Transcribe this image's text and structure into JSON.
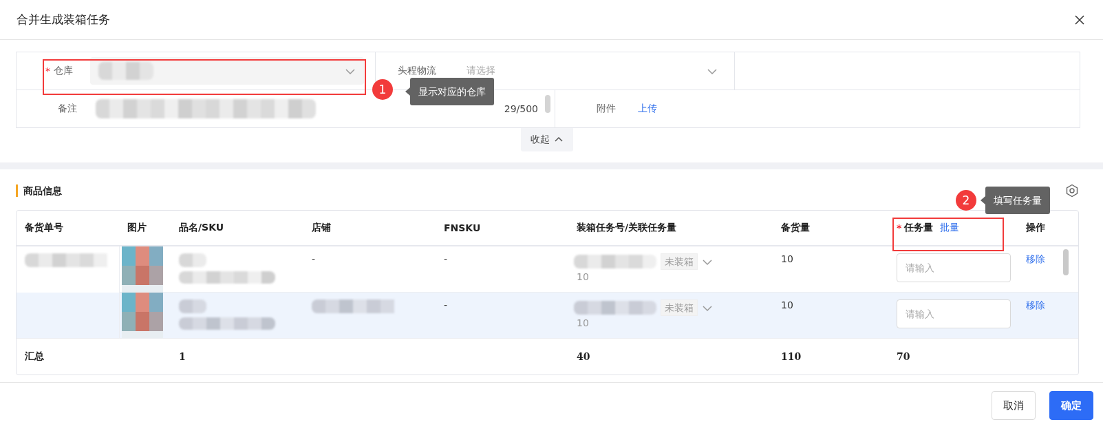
{
  "dialog": {
    "title": "合并生成装箱任务"
  },
  "form": {
    "warehouse": {
      "label": "仓库",
      "required_mark": "*",
      "value": {
        "kind": "redacted"
      }
    },
    "first_leg": {
      "label": "头程物流",
      "placeholder": "请选择"
    },
    "remark": {
      "label": "备注",
      "value": {
        "kind": "redacted"
      },
      "count": "29/500"
    },
    "attachment": {
      "label": "附件",
      "link": "上传"
    },
    "collapse": "收起"
  },
  "section": {
    "title": "商品信息"
  },
  "table": {
    "columns": [
      {
        "label": "备货单号"
      },
      {
        "label": "图片"
      },
      {
        "label": "品名/SKU"
      },
      {
        "label": "店铺"
      },
      {
        "label": "FNSKU"
      },
      {
        "label": "装箱任务号/关联任务量"
      },
      {
        "label": "备货量"
      },
      {
        "label": "任务量",
        "required_mark": "*",
        "link": "批量"
      },
      {
        "label": "操作"
      }
    ],
    "rows": [
      {
        "hovered": false,
        "order_no": {
          "kind": "redacted"
        },
        "name_sku": {
          "kind": "redacted"
        },
        "store": {
          "kind": "text",
          "text": "-"
        },
        "fnsku": "-",
        "box_task": {
          "tag": "未装箱",
          "qty": "10"
        },
        "stock_qty": "10",
        "task_qty": {
          "placeholder": "请输入"
        },
        "action": "移除"
      },
      {
        "hovered": true,
        "name_sku": {
          "kind": "redacted"
        },
        "store": {
          "kind": "redacted"
        },
        "fnsku": "-",
        "box_task": {
          "tag": "未装箱",
          "qty": "10"
        },
        "stock_qty": "10",
        "task_qty": {
          "placeholder": "请输入"
        },
        "action": "移除"
      }
    ],
    "summary": {
      "label": "汇总",
      "name_sku": "1",
      "box_task": "40",
      "stock_qty": "110",
      "task_qty": "70"
    }
  },
  "annotations": [
    {
      "kind": "warehouse",
      "number": "1",
      "text": "显示对应的仓库"
    },
    {
      "kind": "task_qty",
      "number": "2",
      "text": "填写任务量"
    }
  ],
  "buttons": [
    {
      "label": "取消",
      "primary": false
    },
    {
      "label": "确定",
      "primary": true
    }
  ]
}
